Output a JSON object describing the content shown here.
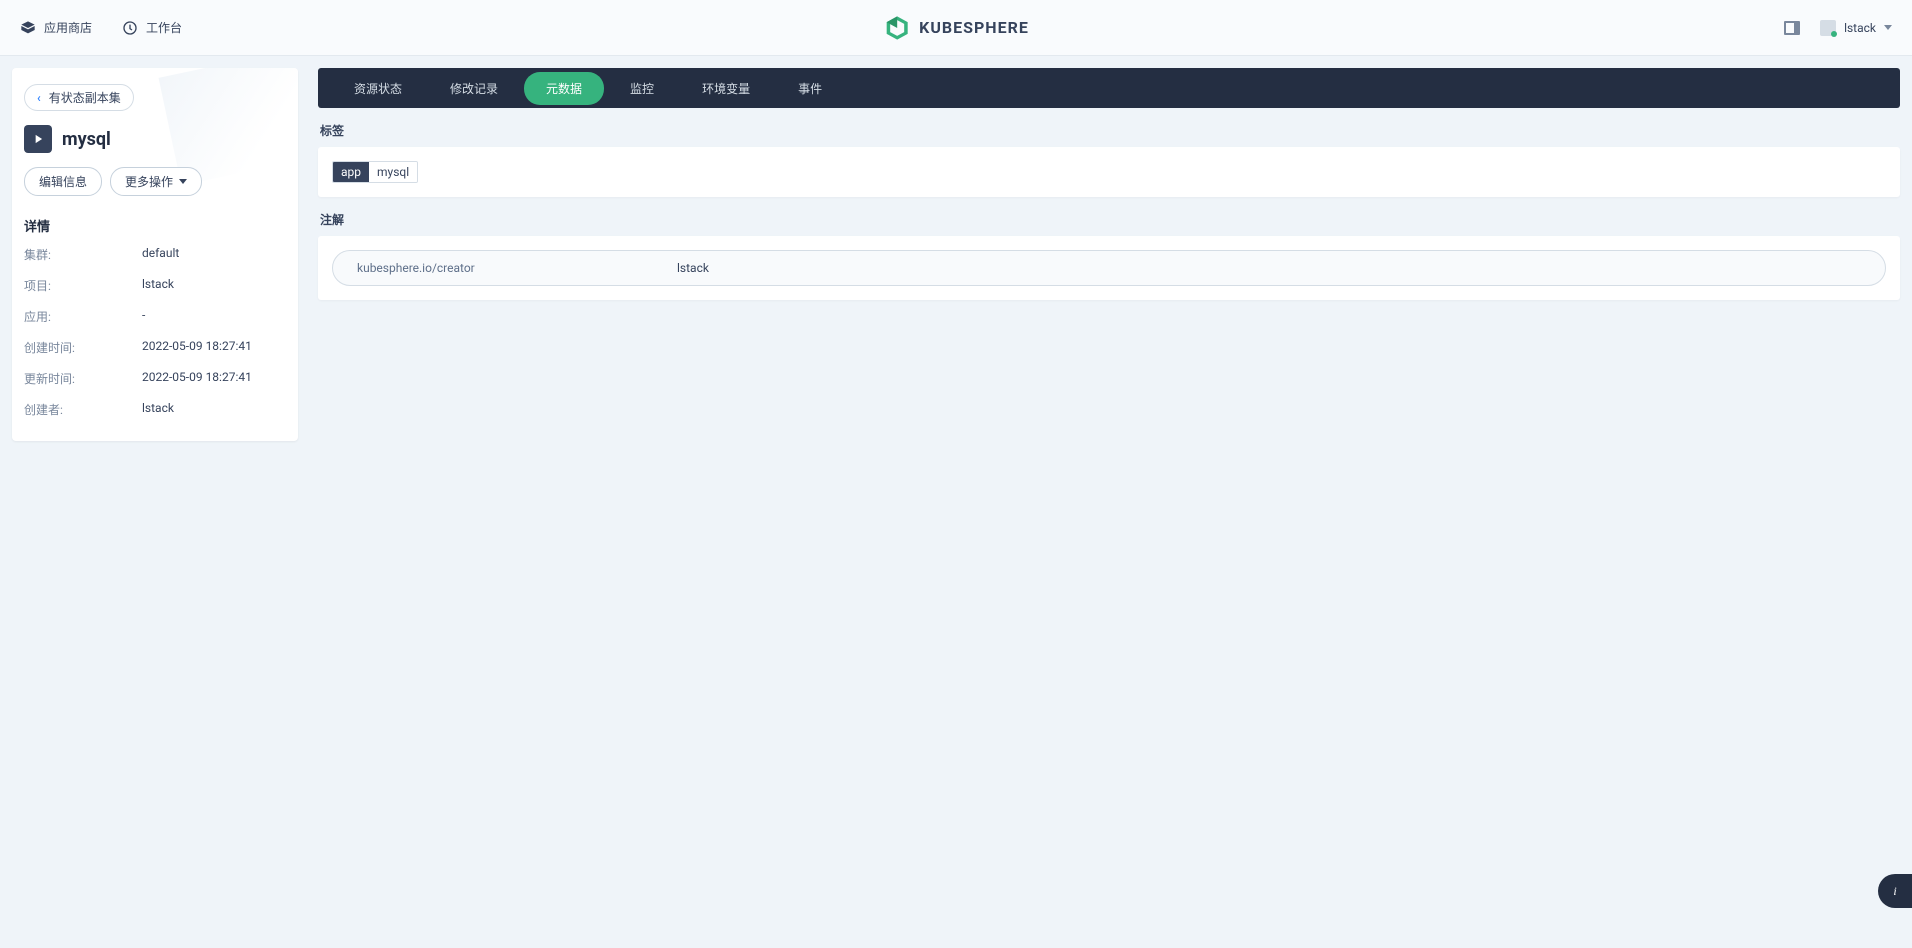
{
  "header": {
    "app_store": "应用商店",
    "workbench": "工作台",
    "brand": "KUBESPHERE",
    "username": "lstack"
  },
  "sidebar": {
    "back_label": "有状态副本集",
    "app_name": "mysql",
    "edit_info_btn": "编辑信息",
    "more_btn": "更多操作",
    "details_title": "详情",
    "details": [
      {
        "label": "集群:",
        "value": "default"
      },
      {
        "label": "项目:",
        "value": "lstack"
      },
      {
        "label": "应用:",
        "value": "-"
      },
      {
        "label": "创建时间:",
        "value": "2022-05-09 18:27:41"
      },
      {
        "label": "更新时间:",
        "value": "2022-05-09 18:27:41"
      },
      {
        "label": "创建者:",
        "value": "lstack"
      }
    ]
  },
  "tabs": {
    "items": [
      {
        "label": "资源状态",
        "active": false
      },
      {
        "label": "修改记录",
        "active": false
      },
      {
        "label": "元数据",
        "active": true
      },
      {
        "label": "监控",
        "active": false
      },
      {
        "label": "环境变量",
        "active": false
      },
      {
        "label": "事件",
        "active": false
      }
    ]
  },
  "content": {
    "labels_heading": "标签",
    "tags": [
      {
        "key": "app",
        "value": "mysql"
      }
    ],
    "annotations_heading": "注解",
    "annotations": [
      {
        "key": "kubesphere.io/creator",
        "value": "lstack"
      }
    ]
  }
}
